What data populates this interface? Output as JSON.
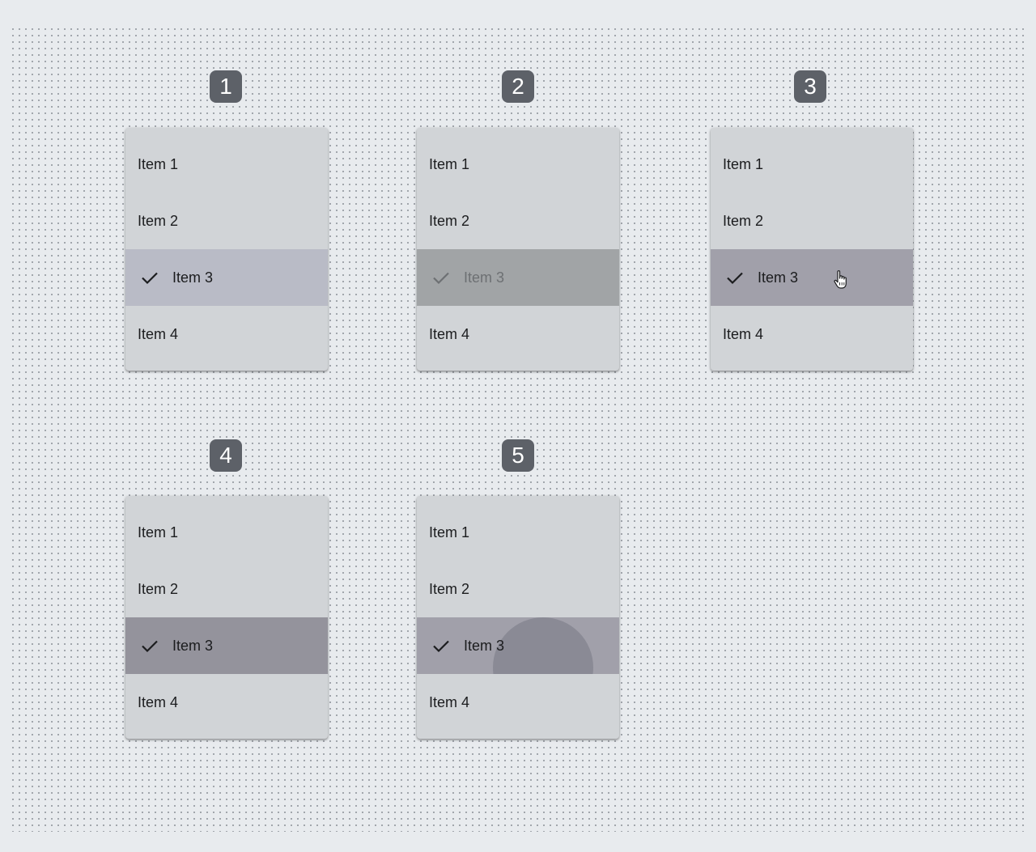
{
  "badges": [
    "1",
    "2",
    "3",
    "4",
    "5"
  ],
  "menus": [
    {
      "state_color": "#b9bbc6",
      "items": [
        {
          "label": "Item 1",
          "selected": false
        },
        {
          "label": "Item 2",
          "selected": false
        },
        {
          "label": "Item 3",
          "selected": true
        },
        {
          "label": "Item 4",
          "selected": false
        }
      ]
    },
    {
      "state_color": "#a1a4a6",
      "items": [
        {
          "label": "Item 1",
          "selected": false
        },
        {
          "label": "Item 2",
          "selected": false
        },
        {
          "label": "Item 3",
          "selected": true,
          "disabled": true
        },
        {
          "label": "Item 4",
          "selected": false
        }
      ]
    },
    {
      "state_color": "#a1a0aa",
      "items": [
        {
          "label": "Item 1",
          "selected": false
        },
        {
          "label": "Item 2",
          "selected": false
        },
        {
          "label": "Item 3",
          "selected": true
        },
        {
          "label": "Item 4",
          "selected": false
        }
      ]
    },
    {
      "state_color": "#94939c",
      "items": [
        {
          "label": "Item 1",
          "selected": false
        },
        {
          "label": "Item 2",
          "selected": false
        },
        {
          "label": "Item 3",
          "selected": true
        },
        {
          "label": "Item 4",
          "selected": false
        }
      ]
    },
    {
      "state_color": "#a1a0aa",
      "items": [
        {
          "label": "Item 1",
          "selected": false
        },
        {
          "label": "Item 2",
          "selected": false
        },
        {
          "label": "Item 3",
          "selected": true
        },
        {
          "label": "Item 4",
          "selected": false
        }
      ]
    }
  ],
  "icons": {
    "selected_check": "check-icon",
    "pointer": "hand-pointer-icon"
  },
  "colors": {
    "menu_surface": "#d1d4d7",
    "badge_bg": "#5d6168",
    "text": "#1b1c1e",
    "disabled_text": "#6d7073",
    "ripple": "#8a8a95"
  }
}
